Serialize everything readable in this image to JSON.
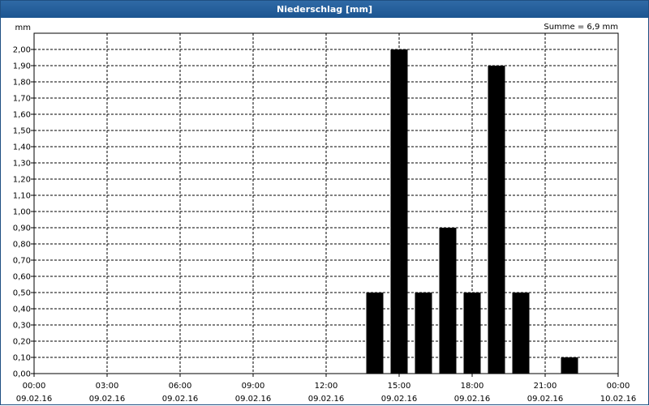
{
  "window": {
    "title": "Niederschlag [mm]"
  },
  "chart_data": {
    "type": "bar",
    "title": "Niederschlag [mm]",
    "ylabel": "mm",
    "annotation": "Summe = 6,9 mm",
    "ylim": [
      0,
      2.1
    ],
    "yticks": [
      "0,00",
      "0,10",
      "0,20",
      "0,30",
      "0,40",
      "0,50",
      "0,60",
      "0,70",
      "0,80",
      "0,90",
      "1,00",
      "1,10",
      "1,20",
      "1,30",
      "1,40",
      "1,50",
      "1,60",
      "1,70",
      "1,80",
      "1,90",
      "2,00"
    ],
    "xlim_hours": [
      0,
      24
    ],
    "xticks": [
      {
        "hour": 0,
        "time": "00:00",
        "date": "09.02.16"
      },
      {
        "hour": 3,
        "time": "03:00",
        "date": "09.02.16"
      },
      {
        "hour": 6,
        "time": "06:00",
        "date": "09.02.16"
      },
      {
        "hour": 9,
        "time": "09:00",
        "date": "09.02.16"
      },
      {
        "hour": 12,
        "time": "12:00",
        "date": "09.02.16"
      },
      {
        "hour": 15,
        "time": "15:00",
        "date": "09.02.16"
      },
      {
        "hour": 18,
        "time": "18:00",
        "date": "09.02.16"
      },
      {
        "hour": 21,
        "time": "21:00",
        "date": "09.02.16"
      },
      {
        "hour": 24,
        "time": "00:00",
        "date": "10.02.16"
      }
    ],
    "bar_width_hours": 0.7,
    "bars": [
      {
        "hour": 14,
        "value": 0.5
      },
      {
        "hour": 15,
        "value": 2.0
      },
      {
        "hour": 16,
        "value": 0.5
      },
      {
        "hour": 17,
        "value": 0.9
      },
      {
        "hour": 18,
        "value": 0.5
      },
      {
        "hour": 19,
        "value": 1.9
      },
      {
        "hour": 20,
        "value": 0.5
      },
      {
        "hour": 22,
        "value": 0.1
      }
    ],
    "grid": true,
    "colors": {
      "bar": "#000000",
      "grid": "#000000",
      "titlebar": "#1f5b98"
    }
  }
}
